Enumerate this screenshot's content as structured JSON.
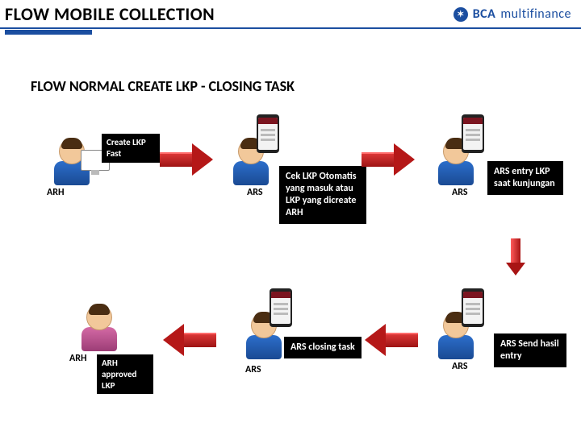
{
  "header": {
    "title": "FLOW MOBILE COLLECTION",
    "brand_short": "BCA",
    "brand_suffix": "multifinance"
  },
  "subtitle": "FLOW NORMAL CREATE LKP - CLOSING TASK",
  "roles": {
    "arh": "ARH",
    "ars": "ARS"
  },
  "steps": {
    "s1_box": "Create LKP Fast",
    "s2_box": "Cek LKP Otomatis yang masuk atau LKP yang dicreate ARH",
    "s3_box": "ARS entry LKP  saat kunjungan",
    "s4_box": "ARS Send hasil entry",
    "s5_box": "ARS closing task",
    "s6_box": "ARH approved LKP"
  }
}
